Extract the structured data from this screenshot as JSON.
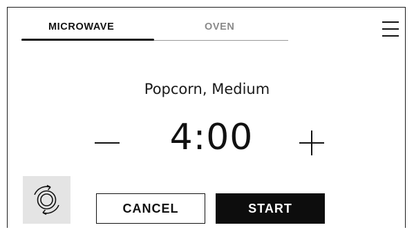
{
  "tabs": [
    {
      "label": "MICROWAVE",
      "active": true
    },
    {
      "label": "OVEN",
      "active": false
    }
  ],
  "menu": {
    "icon": "hamburger-menu-icon"
  },
  "program": {
    "name": "Popcorn, Medium"
  },
  "timer": {
    "value": "4:00"
  },
  "controls": {
    "decrease_icon": "minus-icon",
    "increase_icon": "plus-icon",
    "turntable_icon": "turntable-rotate-icon",
    "cancel_label": "CANCEL",
    "start_label": "START"
  },
  "colors": {
    "accent": "#111111",
    "inactive_tab": "#8a8a8a",
    "turntable_bg": "#e4e4e4",
    "start_bg": "#0d0d0d"
  }
}
